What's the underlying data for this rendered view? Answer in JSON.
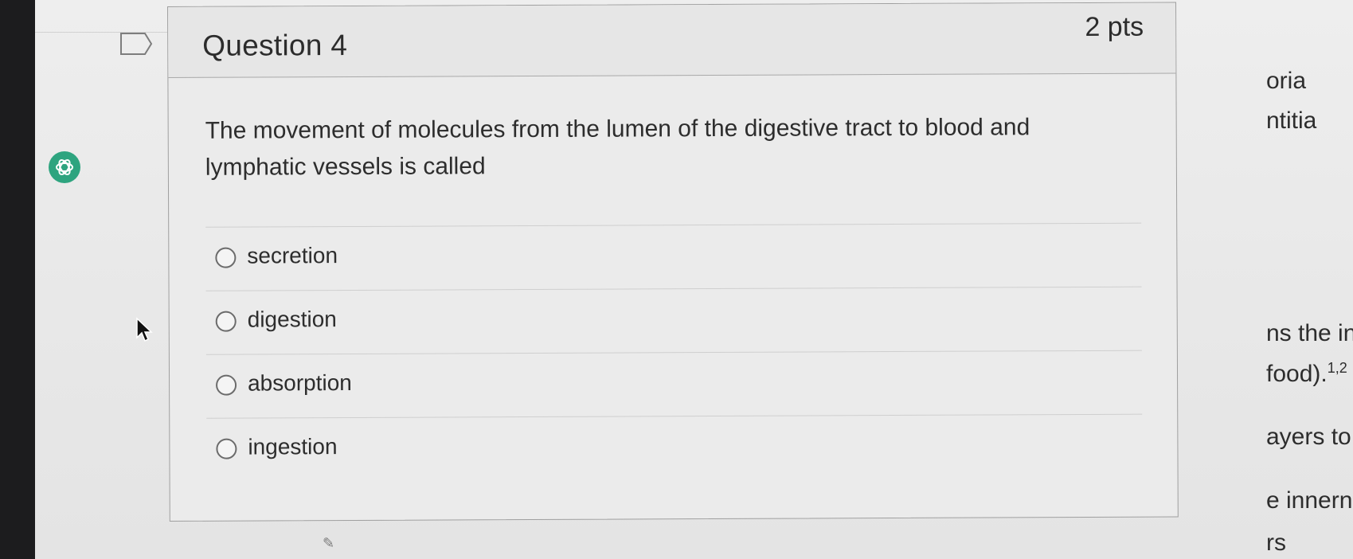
{
  "question": {
    "title": "Question 4",
    "points": "2 pts",
    "text": "The movement of molecules from the lumen of the digestive tract to blood and lymphatic vessels is called",
    "options": [
      "secretion",
      "digestion",
      "absorption",
      "ingestion"
    ]
  },
  "side_fragments": {
    "l1": "oria",
    "l2": "ntitia",
    "l3": "ns the in",
    "l4": "food).",
    "l4_sup": "1,2",
    "l5": "ayers to",
    "l6": "e innern",
    "l7": "rs"
  },
  "icons": {
    "flag": "bookmark-flag-icon",
    "assistant": "chatgpt-extension-icon",
    "cursor": "mouse-pointer-icon"
  },
  "colors": {
    "assistant_badge": "#2ea47f",
    "text": "#2d2d2d"
  }
}
